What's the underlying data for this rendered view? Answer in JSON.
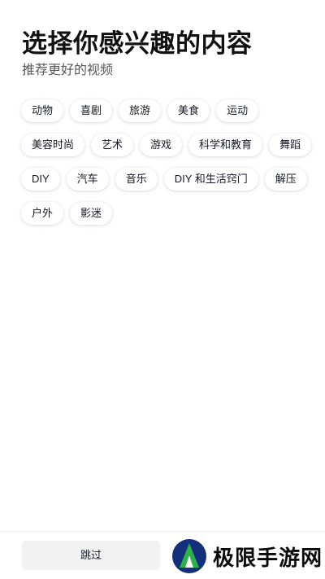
{
  "header": {
    "title": "选择你感兴趣的内容",
    "subtitle": "推荐更好的视频"
  },
  "interest_rows": [
    [
      "动物",
      "喜剧",
      "旅游",
      "美食",
      "运动"
    ],
    [
      "美容时尚",
      "艺术",
      "游戏",
      "科学和教育",
      "舞蹈"
    ],
    [
      "DIY",
      "汽车",
      "音乐",
      "DIY 和生活窍门",
      "解压"
    ],
    [
      "户外",
      "影迷"
    ]
  ],
  "footer": {
    "skip_label": "跳过"
  },
  "watermark": {
    "text": "极限手游网"
  },
  "colors": {
    "chip_background": "#ffffff",
    "skip_background": "#f1f1f2",
    "logo_blue": "#14307a",
    "logo_green": "#2bb34a"
  }
}
